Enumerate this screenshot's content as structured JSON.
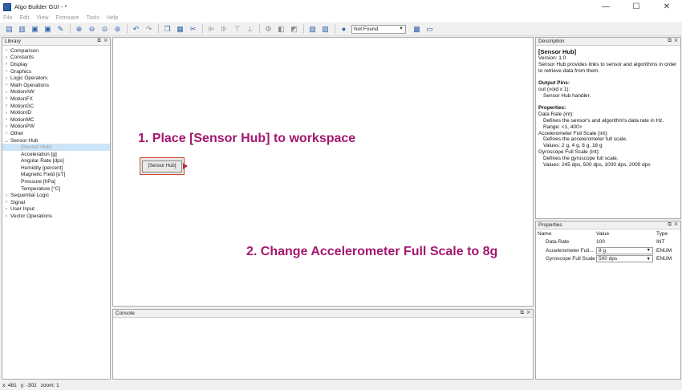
{
  "window": {
    "title": "Algo Builder GUI - *",
    "controls": [
      "—",
      "☐",
      "✕"
    ]
  },
  "menu": [
    "File",
    "Edit",
    "View",
    "Firmware",
    "Tools",
    "Help"
  ],
  "toolbar": {
    "combo_value": "Not Found"
  },
  "library": {
    "title": "Library",
    "header_controls": "⧉ ✕",
    "items": [
      {
        "label": "Comparison",
        "expanded": false
      },
      {
        "label": "Constants",
        "expanded": false
      },
      {
        "label": "Display",
        "expanded": false
      },
      {
        "label": "Graphics",
        "expanded": false
      },
      {
        "label": "Logic Operators",
        "expanded": false
      },
      {
        "label": "Math Operations",
        "expanded": false
      },
      {
        "label": "MotionAW",
        "expanded": false
      },
      {
        "label": "MotionFX",
        "expanded": false
      },
      {
        "label": "MotionGC",
        "expanded": false
      },
      {
        "label": "MotionID",
        "expanded": false
      },
      {
        "label": "MotionMC",
        "expanded": false
      },
      {
        "label": "MotionPW",
        "expanded": false
      },
      {
        "label": "Other",
        "expanded": false
      },
      {
        "label": "Sensor Hub",
        "expanded": true,
        "children": [
          "[Sensor Hub]",
          "Acceleration [g]",
          "Angular Rate [dps]",
          "Humidity [percent]",
          "Magnetic Field [uT]",
          "Pressure [hPa]",
          "Temperature [°C]"
        ]
      },
      {
        "label": "Sequential Logic",
        "expanded": false
      },
      {
        "label": "Signal",
        "expanded": false
      },
      {
        "label": "User Input",
        "expanded": false
      },
      {
        "label": "Vector Operations",
        "expanded": false
      }
    ]
  },
  "workspace": {
    "annotation_1": "1. Place [Sensor Hub] to workspace",
    "annotation_2": "2. Change Accelerometer Full Scale to 8g",
    "block_label": "[Sensor Hub]"
  },
  "console": {
    "title": "Console",
    "header_controls": "⧉ ✕"
  },
  "description": {
    "title": "Description",
    "header_controls": "⧉ ✕",
    "block_title": "[Sensor Hub]",
    "version": "Version: 1.0",
    "summary": "Sensor Hub provides links to sensor and algorithms in order to retrieve data from them.",
    "output_pins_label": "Output Pins:",
    "output_pin": "out (void x 1):",
    "output_pin_desc": "Sensor Hub handler.",
    "properties_label": "Properties:",
    "prop1_name": "Data Rate (int):",
    "prop1_desc": "Defines the sensor's and algorithm's data rate in Hz.",
    "prop1_range": "Range: <1, 400>",
    "prop2_name": "Accelerometer Full Scale (int):",
    "prop2_desc": "Defines the accelerometer full scale.",
    "prop2_values": "Values: 2 g, 4 g, 8 g, 16 g",
    "prop3_name": "Gyroscope Full Scale (int):",
    "prop3_desc": "Defines the gyroscope full scale.",
    "prop3_values": "Values: 245 dps, 500 dps, 1000 dps, 2000 dps"
  },
  "properties": {
    "title": "Properties",
    "header_controls": "⧉ ✕",
    "columns": [
      "Name",
      "Value",
      "Type"
    ],
    "rows": [
      {
        "name": "Data Rate",
        "value": "100",
        "type": "INT",
        "select": false
      },
      {
        "name": "Accelerometer Full...",
        "value": "8 g",
        "type": "ENUM",
        "select": true
      },
      {
        "name": "Gyroscope Full Scale",
        "value": "500 dps",
        "type": "ENUM",
        "select": true
      }
    ]
  },
  "status": {
    "x": "x: 481",
    "y": "y: -302",
    "zoom": "zoom: 1"
  }
}
